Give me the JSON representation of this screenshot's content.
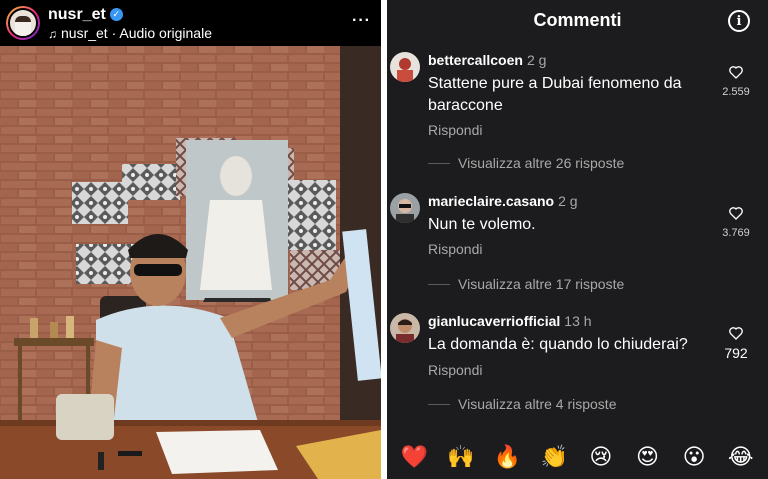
{
  "reel": {
    "username": "nusr_et",
    "audio": "nusr_et · Audio originale",
    "more": "···"
  },
  "comments_panel": {
    "title": "Commenti",
    "info": "i",
    "items": [
      {
        "username": "bettercallcoen",
        "time": "2 g",
        "text": "Stattene pure a Dubai fenomeno da baraccone",
        "reply": "Rispondi",
        "likes": "2.559",
        "view_more": "Visualizza altre 26 risposte"
      },
      {
        "username": "marieclaire.casano",
        "time": "2 g",
        "text": "Nun te volemo.",
        "reply": "Rispondi",
        "likes": "3.769",
        "view_more": "Visualizza altre 17 risposte"
      },
      {
        "username": "gianlucaverriofficial",
        "time": "13 h",
        "text": "La domanda è: quando lo chiuderai?",
        "reply": "Rispondi",
        "likes": "792",
        "view_more": "Visualizza altre 4 risposte"
      }
    ],
    "emojis": [
      "❤️",
      "🙌",
      "🔥",
      "👏",
      "😢",
      "😍",
      "😮",
      "😂"
    ]
  },
  "colors": {
    "panel_bg": "#1c1c1e",
    "secondary_text": "#a8a8a8",
    "verified": "#3897f0"
  }
}
